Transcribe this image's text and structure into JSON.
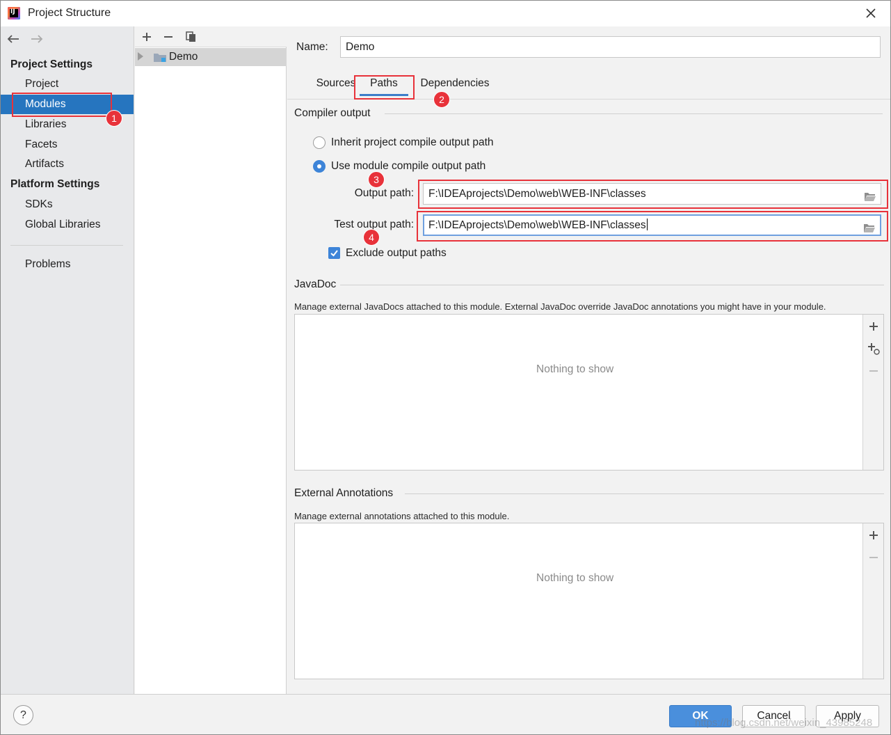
{
  "window": {
    "title": "Project Structure"
  },
  "sidebar": {
    "project_settings_heading": "Project Settings",
    "items_project": [
      {
        "label": "Project"
      },
      {
        "label": "Modules",
        "selected": true
      },
      {
        "label": "Libraries"
      },
      {
        "label": "Facets"
      },
      {
        "label": "Artifacts"
      }
    ],
    "platform_settings_heading": "Platform Settings",
    "items_platform": [
      {
        "label": "SDKs"
      },
      {
        "label": "Global Libraries"
      }
    ],
    "problems_label": "Problems"
  },
  "module_tree": {
    "toolbar": [
      "add-icon",
      "remove-icon",
      "copy-icon"
    ],
    "items": [
      {
        "label": "Demo"
      }
    ]
  },
  "details": {
    "name_label": "Name:",
    "name_value": "Demo",
    "tabs": [
      {
        "label": "Sources"
      },
      {
        "label": "Paths",
        "active": true
      },
      {
        "label": "Dependencies"
      }
    ],
    "compiler_output": {
      "title": "Compiler output",
      "option_inherit": "Inherit project compile output path",
      "option_module": "Use module compile output path",
      "selected_option": "module",
      "output_path_label": "Output path:",
      "output_path_value": "F:\\IDEAprojects\\Demo\\web\\WEB-INF\\classes",
      "test_output_path_label": "Test output path:",
      "test_output_path_value": "F:\\IDEAprojects\\Demo\\web\\WEB-INF\\classes",
      "exclude_label": "Exclude output paths",
      "exclude_checked": true
    },
    "javadoc": {
      "title": "JavaDoc",
      "description": "Manage external JavaDocs attached to this module. External JavaDoc override JavaDoc annotations you might have in your module.",
      "empty_text": "Nothing to show"
    },
    "external_annotations": {
      "title": "External Annotations",
      "description": "Manage external annotations attached to this module.",
      "empty_text": "Nothing to show"
    }
  },
  "footer": {
    "help_label": "?",
    "ok_label": "OK",
    "cancel_label": "Cancel",
    "apply_label": "Apply",
    "watermark": "https://blog.csdn.net/weixin_43985248"
  },
  "annotations": {
    "badges": [
      "1",
      "2",
      "3",
      "4"
    ],
    "color": "#e8323a"
  },
  "colors": {
    "selection": "#2675bf",
    "accent": "#3d84d8",
    "highlight": "#e8323a"
  }
}
